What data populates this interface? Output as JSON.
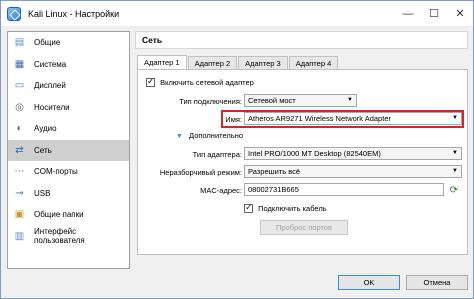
{
  "window": {
    "title": "Kali Linux - Настройки"
  },
  "titlebar": {
    "minimize": "—",
    "maximize": "☐",
    "close": "✕"
  },
  "sidebar": {
    "items": [
      {
        "label": "Общие",
        "icon": "general-icon",
        "glyph": "▤",
        "color": "#5b8fc7"
      },
      {
        "label": "Система",
        "icon": "system-icon",
        "glyph": "▦",
        "color": "#3a6ea8"
      },
      {
        "label": "Дисплей",
        "icon": "display-icon",
        "glyph": "▭",
        "color": "#3a7bd5"
      },
      {
        "label": "Носители",
        "icon": "storage-icon",
        "glyph": "◎",
        "color": "#5a5a5a"
      },
      {
        "label": "Аудио",
        "icon": "audio-icon",
        "glyph": "◐",
        "color": "#666666"
      },
      {
        "label": "Сеть",
        "icon": "network-icon",
        "glyph": "⇄",
        "color": "#2f6ab3"
      },
      {
        "label": "COM-порты",
        "icon": "serial-ports-icon",
        "glyph": "⋯",
        "color": "#4a8a4a"
      },
      {
        "label": "USB",
        "icon": "usb-icon",
        "glyph": "⊸",
        "color": "#2f6ab3"
      },
      {
        "label": "Общие папки",
        "icon": "shared-folders-icon",
        "glyph": "▣",
        "color": "#c99a2e"
      },
      {
        "label": "Интерфейс пользователя",
        "icon": "user-interface-icon",
        "glyph": "▥",
        "color": "#5b8fc7"
      }
    ],
    "active_index": 5
  },
  "content": {
    "section_title": "Сеть",
    "tabs": [
      "Адаптер 1",
      "Адаптер 2",
      "Адаптер 3",
      "Адаптер 4"
    ],
    "active_tab": 0,
    "enable_adapter_label": "Включить сетевой адаптер",
    "attached_to_label": "Тип подключения:",
    "attached_to_value": "Сетевой мост",
    "name_label": "Имя:",
    "name_value": "Atheros AR9271 Wireless Network Adapter",
    "advanced_label": "Дополнительно",
    "adapter_type_label": "Тип адаптера:",
    "adapter_type_value": "Intel PRO/1000 MT Desktop (82540EM)",
    "promiscuous_label": "Неразборчивый режим:",
    "promiscuous_value": "Разрешить всё",
    "mac_label": "MAC-адрес:",
    "mac_value": "08002731B665",
    "cable_label": "Подключить кабель",
    "port_forwarding_label": "Проброс портов"
  },
  "footer": {
    "ok_label": "OK",
    "cancel_label": "Отмена"
  }
}
